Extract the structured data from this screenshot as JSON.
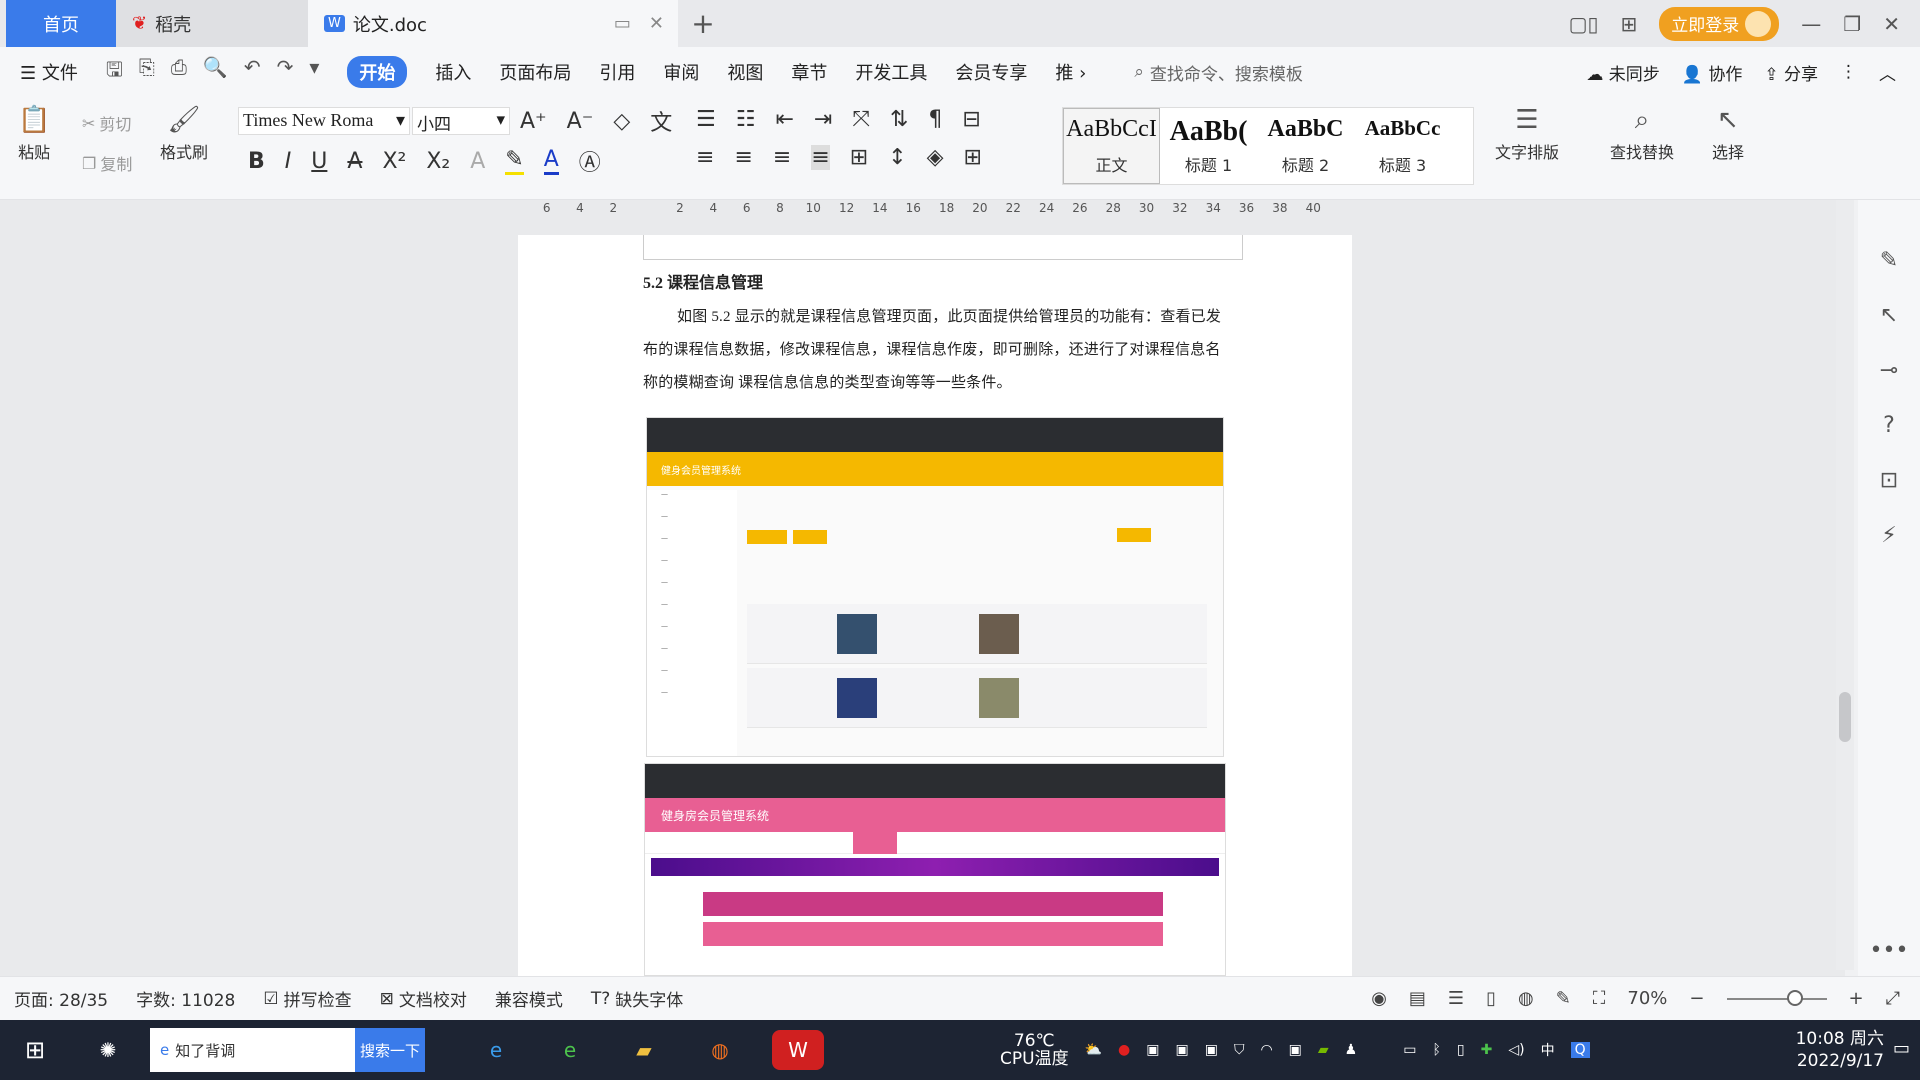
{
  "tabs": {
    "home": "首页",
    "daoke": "稻壳",
    "doc": "论文.doc",
    "new_tab": "+"
  },
  "window": {
    "login": "立即登录"
  },
  "menu": {
    "file": "文件",
    "items": [
      "开始",
      "插入",
      "页面布局",
      "引用",
      "审阅",
      "视图",
      "章节",
      "开发工具",
      "会员专享",
      "推"
    ],
    "search_placeholder": "查找命令、搜索模板",
    "sync": "未同步",
    "collab": "协作",
    "share": "分享"
  },
  "ribbon": {
    "paste": "粘贴",
    "cut": "剪切",
    "copy": "复制",
    "format_painter": "格式刷",
    "font_name": "Times New Roma",
    "font_size": "小四",
    "styles": [
      {
        "preview": "AaBbCcI",
        "label": "正文"
      },
      {
        "preview": "AaBb(",
        "label": "标题 1"
      },
      {
        "preview": "AaBbC",
        "label": "标题 2"
      },
      {
        "preview": "AaBbCc",
        "label": "标题 3"
      }
    ],
    "text_layout": "文字排版",
    "find_replace": "查找替换",
    "select": "选择"
  },
  "ruler": [
    "6",
    "4",
    "2",
    "",
    "2",
    "4",
    "6",
    "8",
    "10",
    "12",
    "14",
    "16",
    "18",
    "20",
    "22",
    "24",
    "26",
    "28",
    "30",
    "32",
    "34",
    "36",
    "38",
    "40"
  ],
  "document": {
    "heading": "5.2  课程信息管理",
    "paragraph": "如图 5.2 显示的就是课程信息管理页面，此页面提供给管理员的功能有：查看已发布的课程信息数据，修改课程信息，课程信息作废，即可删除，还进行了对课程信息名称的模糊查询 课程信息信息的类型查询等等一些条件。",
    "shot1_title": "健身会员管理系统",
    "shot2_title": "健身房会员管理系统"
  },
  "status": {
    "page": "页面: 28/35",
    "words": "字数: 11028",
    "spell": "拼写检查",
    "proof": "文档校对",
    "compat": "兼容模式",
    "missing_font": "缺失字体",
    "zoom": "70%"
  },
  "taskbar": {
    "search_text": "知了背调",
    "search_btn": "搜索一下",
    "temp": "76℃",
    "temp_label": "CPU温度",
    "ime": "中",
    "time": "10:08 周六",
    "date": "2022/9/17"
  },
  "colors": {
    "accent": "#3a7bea",
    "login": "#f0a020",
    "yellow_header": "#f5b800",
    "pink_header": "#e85f93"
  }
}
